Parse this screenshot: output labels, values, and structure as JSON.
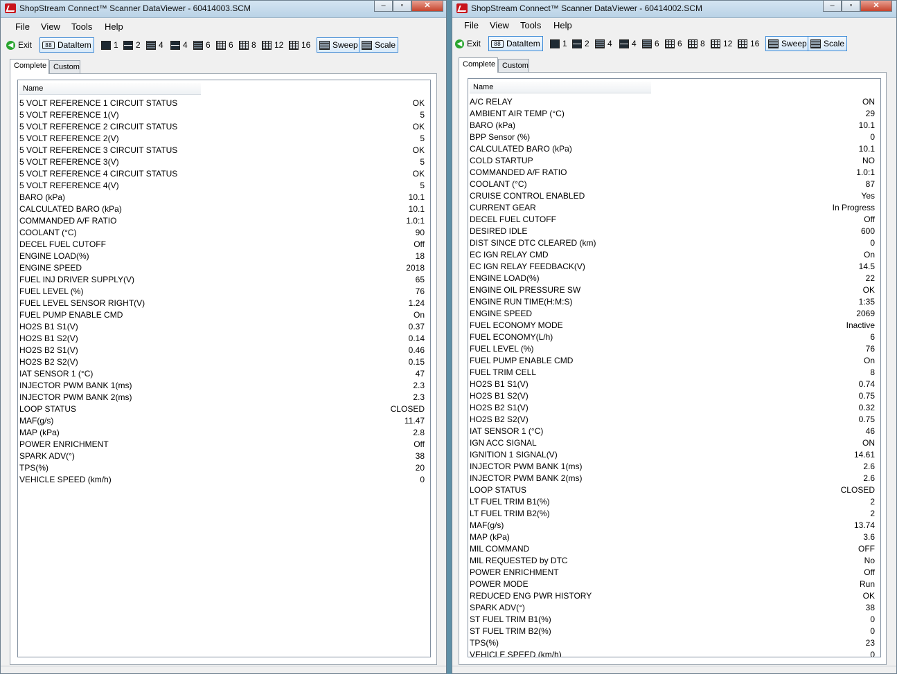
{
  "menu": [
    "File",
    "View",
    "Tools",
    "Help"
  ],
  "toolbar": {
    "exit": "Exit",
    "dataitem": "DataItem",
    "layouts": [
      "1",
      "2",
      "4",
      "4",
      "6",
      "6",
      "8",
      "12",
      "16"
    ],
    "sweep": "Sweep",
    "scale": "Scale"
  },
  "tabs": [
    "Complete",
    "Custom"
  ],
  "column_header": "Name",
  "left": {
    "title": "ShopStream Connect™ Scanner DataViewer - 60414003.SCM",
    "rows": [
      [
        "5 VOLT REFERENCE 1 CIRCUIT STATUS",
        "OK"
      ],
      [
        "5 VOLT REFERENCE 1(V)",
        "5"
      ],
      [
        "5 VOLT REFERENCE 2 CIRCUIT STATUS",
        "OK"
      ],
      [
        "5 VOLT REFERENCE 2(V)",
        "5"
      ],
      [
        "5 VOLT REFERENCE 3 CIRCUIT STATUS",
        "OK"
      ],
      [
        "5 VOLT REFERENCE 3(V)",
        "5"
      ],
      [
        "5 VOLT REFERENCE 4 CIRCUIT STATUS",
        "OK"
      ],
      [
        "5 VOLT REFERENCE 4(V)",
        "5"
      ],
      [
        "BARO (kPa)",
        "10.1"
      ],
      [
        "CALCULATED BARO (kPa)",
        "10.1"
      ],
      [
        "COMMANDED A/F RATIO",
        "1.0:1"
      ],
      [
        "COOLANT (°C)",
        "90"
      ],
      [
        "DECEL FUEL CUTOFF",
        "Off"
      ],
      [
        "ENGINE LOAD(%)",
        "18"
      ],
      [
        "ENGINE SPEED",
        "2018"
      ],
      [
        "FUEL INJ DRIVER SUPPLY(V)",
        "65"
      ],
      [
        "FUEL LEVEL (%)",
        "76"
      ],
      [
        "FUEL LEVEL SENSOR RIGHT(V)",
        "1.24"
      ],
      [
        "FUEL PUMP ENABLE CMD",
        "On"
      ],
      [
        "HO2S B1 S1(V)",
        "0.37"
      ],
      [
        "HO2S B1 S2(V)",
        "0.14"
      ],
      [
        "HO2S B2 S1(V)",
        "0.46"
      ],
      [
        "HO2S B2 S2(V)",
        "0.15"
      ],
      [
        "IAT SENSOR 1 (°C)",
        "47"
      ],
      [
        "INJECTOR PWM BANK 1(ms)",
        "2.3"
      ],
      [
        "INJECTOR PWM BANK 2(ms)",
        "2.3"
      ],
      [
        "LOOP STATUS",
        "CLOSED"
      ],
      [
        "MAF(g/s)",
        "11.47"
      ],
      [
        "MAP (kPa)",
        "2.8"
      ],
      [
        "POWER ENRICHMENT",
        "Off"
      ],
      [
        "SPARK ADV(°)",
        "38"
      ],
      [
        "TPS(%)",
        "20"
      ],
      [
        "VEHICLE SPEED (km/h)",
        "0"
      ]
    ]
  },
  "right": {
    "title": "ShopStream Connect™ Scanner DataViewer - 60414002.SCM",
    "rows": [
      [
        "A/C RELAY",
        "ON"
      ],
      [
        "AMBIENT AIR TEMP (°C)",
        "29"
      ],
      [
        "BARO (kPa)",
        "10.1"
      ],
      [
        "BPP Sensor (%)",
        "0"
      ],
      [
        "CALCULATED BARO (kPa)",
        "10.1"
      ],
      [
        "COLD STARTUP",
        "NO"
      ],
      [
        "COMMANDED A/F RATIO",
        "1.0:1"
      ],
      [
        "COOLANT (°C)",
        "87"
      ],
      [
        "CRUISE CONTROL ENABLED",
        "Yes"
      ],
      [
        "CURRENT GEAR",
        "In Progress"
      ],
      [
        "DECEL FUEL CUTOFF",
        "Off"
      ],
      [
        "DESIRED IDLE",
        "600"
      ],
      [
        "DIST SINCE DTC CLEARED (km)",
        "0"
      ],
      [
        "EC IGN RELAY CMD",
        "On"
      ],
      [
        "EC IGN RELAY FEEDBACK(V)",
        "14.5"
      ],
      [
        "ENGINE LOAD(%)",
        "22"
      ],
      [
        "ENGINE OIL PRESSURE SW",
        "OK"
      ],
      [
        "ENGINE RUN TIME(H:M:S)",
        "1:35"
      ],
      [
        "ENGINE SPEED",
        "2069"
      ],
      [
        "FUEL ECONOMY MODE",
        "Inactive"
      ],
      [
        "FUEL ECONOMY(L/h)",
        "6"
      ],
      [
        "FUEL LEVEL (%)",
        "76"
      ],
      [
        "FUEL PUMP ENABLE CMD",
        "On"
      ],
      [
        "FUEL TRIM CELL",
        "8"
      ],
      [
        "HO2S B1 S1(V)",
        "0.74"
      ],
      [
        "HO2S B1 S2(V)",
        "0.75"
      ],
      [
        "HO2S B2 S1(V)",
        "0.32"
      ],
      [
        "HO2S B2 S2(V)",
        "0.75"
      ],
      [
        "IAT SENSOR 1 (°C)",
        "46"
      ],
      [
        "IGN ACC SIGNAL",
        "ON"
      ],
      [
        "IGNITION 1 SIGNAL(V)",
        "14.61"
      ],
      [
        "INJECTOR PWM BANK 1(ms)",
        "2.6"
      ],
      [
        "INJECTOR PWM BANK 2(ms)",
        "2.6"
      ],
      [
        "LOOP STATUS",
        "CLOSED"
      ],
      [
        "LT FUEL TRIM B1(%)",
        "2"
      ],
      [
        "LT FUEL TRIM B2(%)",
        "2"
      ],
      [
        "MAF(g/s)",
        "13.74"
      ],
      [
        "MAP (kPa)",
        "3.6"
      ],
      [
        "MIL COMMAND",
        "OFF"
      ],
      [
        "MIL REQUESTED by DTC",
        "No"
      ],
      [
        "POWER ENRICHMENT",
        "Off"
      ],
      [
        "POWER MODE",
        "Run"
      ],
      [
        "REDUCED ENG PWR HISTORY",
        "OK"
      ],
      [
        "SPARK ADV(°)",
        "38"
      ],
      [
        "ST FUEL TRIM B1(%)",
        "0"
      ],
      [
        "ST FUEL TRIM B2(%)",
        "0"
      ],
      [
        "TPS(%)",
        "23"
      ],
      [
        "VEHICLE SPEED (km/h)",
        "0"
      ]
    ]
  }
}
